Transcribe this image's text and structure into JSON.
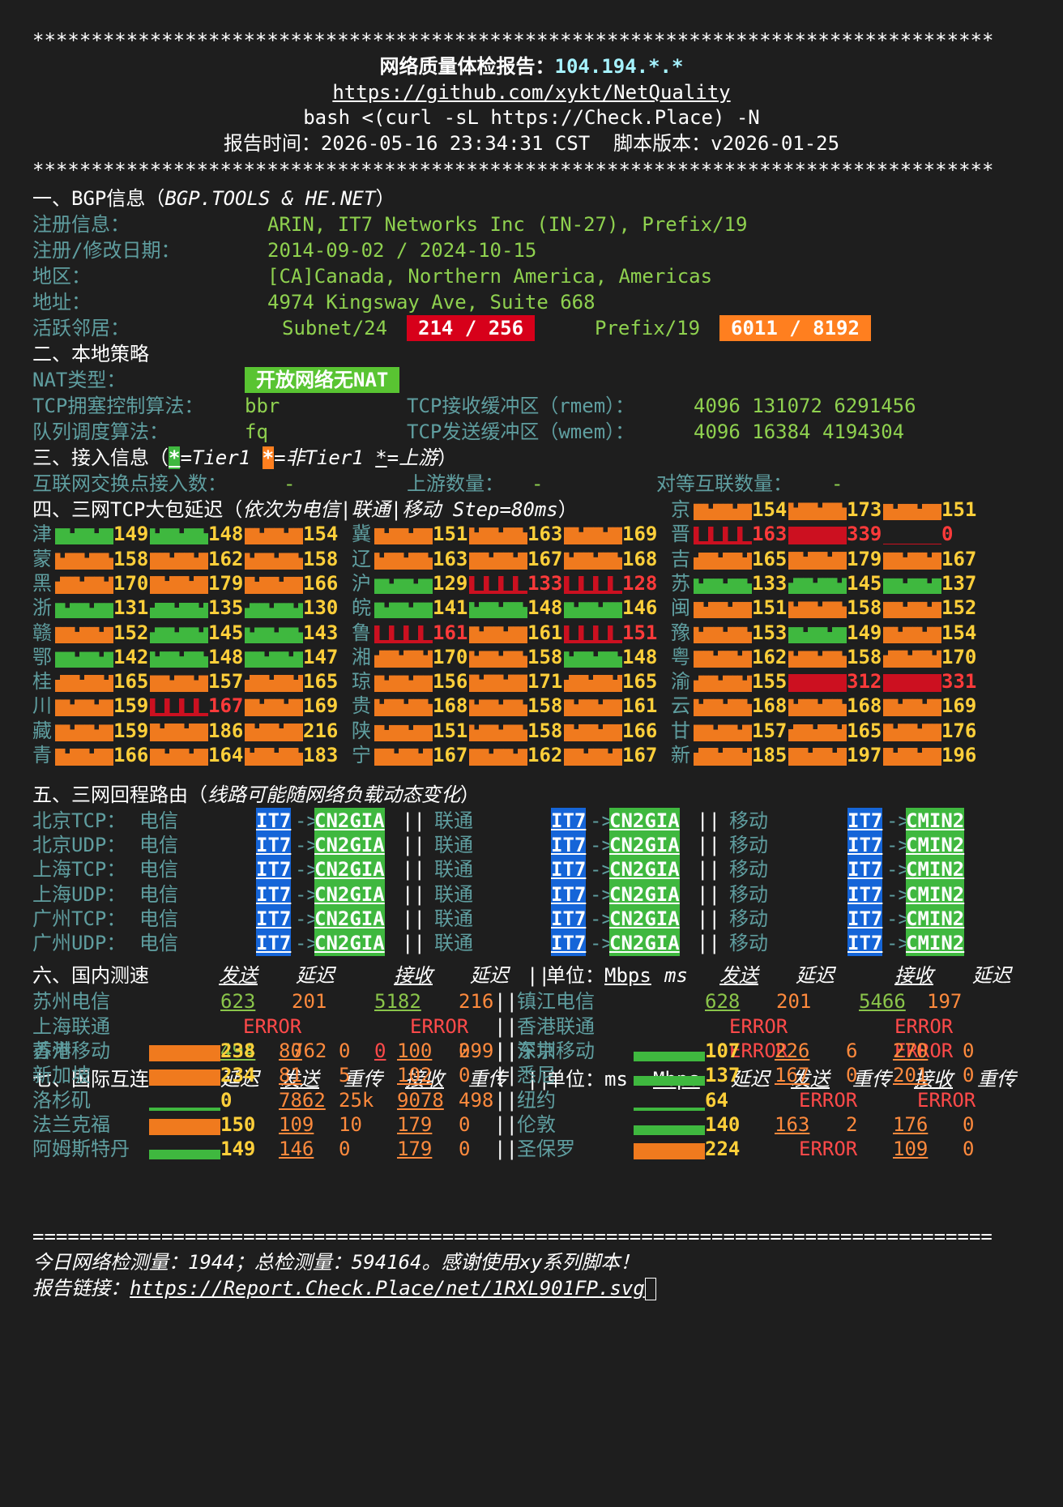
{
  "header": {
    "stars": "**********************************************************************************",
    "title": "网络质量体检报告：",
    "ip": "104.194.*.*",
    "repo": "https://github.com/xykt/NetQuality",
    "cmd": "bash <(curl -sL https://Check.Place) -N",
    "report_time": "报告时间：2026-05-16 23:34:31 CST  脚本版本：v2026-01-25"
  },
  "bgp": {
    "section": "一、BGP信息（",
    "section_src": "BGP.TOOLS & HE.NET",
    "section_end": "）",
    "rows": [
      {
        "label": "注册信息：",
        "value": "ARIN, IT7 Networks Inc (IN-27), Prefix/19"
      },
      {
        "label": "注册/修改日期：",
        "value": "2014-09-02 / 2024-10-15"
      },
      {
        "label": "地区：",
        "value": "[CA]Canada, Northern America, Americas"
      },
      {
        "label": "地址：",
        "value": "4974 Kingsway Ave, Suite 668"
      }
    ],
    "neighbor_label": "活跃邻居：",
    "subnet_label": "Subnet/24",
    "subnet_value": "214 / 256",
    "prefix_label": "Prefix/19",
    "prefix_value": "6011 / 8192"
  },
  "local": {
    "section": "二、本地策略",
    "nat_label": "NAT类型：",
    "nat_value": "开放网络无NAT",
    "tcp_cc_label": "TCP拥塞控制算法：",
    "tcp_cc": "bbr",
    "rmem_label": "TCP接收缓冲区（rmem）：",
    "rmem": "4096 131072 6291456",
    "qdisc_label": "队列调度算法：",
    "qdisc": "fq",
    "wmem_label": "TCP发送缓冲区（wmem）：",
    "wmem": "4096 16384 4194304"
  },
  "access": {
    "section": "三、接入信息（",
    "legend_star": "*",
    "tier1": "=Tier1 ",
    "nontier1": "=非Tier1 ",
    "upstream": "=上游",
    "section_end": "）",
    "ix_label": "互联网交换点接入数：",
    "ix_value": "-",
    "up_label": "上游数量：",
    "up_value": "-",
    "peer_label": "对等互联数量：",
    "peer_value": "-"
  },
  "latency": {
    "section": "四、三网TCP大包延迟（",
    "section_note": "依次为电信|联通|移动 Step=80ms",
    "section_end": "）",
    "colors": {
      "green": "#3fb83f",
      "orange": "#f07a1e",
      "red": "#cc1020"
    },
    "provinces": [
      {
        "n": "京",
        "v": [
          "154",
          "173",
          "151"
        ],
        "c": [
          "o",
          "o",
          "o"
        ]
      },
      {
        "n": "津",
        "v": [
          "149",
          "148",
          "154"
        ],
        "c": [
          "g",
          "g",
          "o"
        ]
      },
      {
        "n": "冀",
        "v": [
          "151",
          "163",
          "169"
        ],
        "c": [
          "o",
          "o",
          "o"
        ]
      },
      {
        "n": "晋",
        "v": [
          "163",
          "339",
          "0"
        ],
        "c": [
          "r",
          "r",
          "r"
        ]
      },
      {
        "n": "蒙",
        "v": [
          "158",
          "162",
          "158"
        ],
        "c": [
          "o",
          "o",
          "o"
        ]
      },
      {
        "n": "辽",
        "v": [
          "163",
          "167",
          "168"
        ],
        "c": [
          "o",
          "o",
          "o"
        ]
      },
      {
        "n": "吉",
        "v": [
          "165",
          "179",
          "167"
        ],
        "c": [
          "o",
          "o",
          "o"
        ]
      },
      {
        "n": "黑",
        "v": [
          "170",
          "179",
          "166"
        ],
        "c": [
          "o",
          "o",
          "o"
        ]
      },
      {
        "n": "沪",
        "v": [
          "129",
          "133",
          "128"
        ],
        "c": [
          "g",
          "r",
          "r"
        ]
      },
      {
        "n": "苏",
        "v": [
          "133",
          "145",
          "137"
        ],
        "c": [
          "g",
          "g",
          "g"
        ]
      },
      {
        "n": "浙",
        "v": [
          "131",
          "135",
          "130"
        ],
        "c": [
          "g",
          "g",
          "g"
        ]
      },
      {
        "n": "皖",
        "v": [
          "141",
          "148",
          "146"
        ],
        "c": [
          "g",
          "g",
          "g"
        ]
      },
      {
        "n": "闽",
        "v": [
          "151",
          "158",
          "152"
        ],
        "c": [
          "o",
          "o",
          "o"
        ]
      },
      {
        "n": "赣",
        "v": [
          "152",
          "145",
          "143"
        ],
        "c": [
          "o",
          "g",
          "g"
        ]
      },
      {
        "n": "鲁",
        "v": [
          "161",
          "161",
          "151"
        ],
        "c": [
          "r",
          "o",
          "r"
        ]
      },
      {
        "n": "豫",
        "v": [
          "153",
          "149",
          "154"
        ],
        "c": [
          "o",
          "g",
          "o"
        ]
      },
      {
        "n": "鄂",
        "v": [
          "142",
          "148",
          "147"
        ],
        "c": [
          "g",
          "g",
          "g"
        ]
      },
      {
        "n": "湘",
        "v": [
          "170",
          "158",
          "148"
        ],
        "c": [
          "o",
          "o",
          "g"
        ]
      },
      {
        "n": "粤",
        "v": [
          "162",
          "158",
          "170"
        ],
        "c": [
          "o",
          "o",
          "o"
        ]
      },
      {
        "n": "桂",
        "v": [
          "165",
          "157",
          "165"
        ],
        "c": [
          "o",
          "o",
          "o"
        ]
      },
      {
        "n": "琼",
        "v": [
          "156",
          "171",
          "165"
        ],
        "c": [
          "o",
          "o",
          "o"
        ]
      },
      {
        "n": "渝",
        "v": [
          "155",
          "312",
          "331"
        ],
        "c": [
          "o",
          "r",
          "r"
        ]
      },
      {
        "n": "川",
        "v": [
          "159",
          "167",
          "169"
        ],
        "c": [
          "o",
          "r",
          "o"
        ]
      },
      {
        "n": "贵",
        "v": [
          "168",
          "158",
          "161"
        ],
        "c": [
          "o",
          "o",
          "o"
        ]
      },
      {
        "n": "云",
        "v": [
          "168",
          "168",
          "169"
        ],
        "c": [
          "o",
          "o",
          "o"
        ]
      },
      {
        "n": "藏",
        "v": [
          "159",
          "186",
          "216"
        ],
        "c": [
          "o",
          "o",
          "o"
        ]
      },
      {
        "n": "陕",
        "v": [
          "151",
          "158",
          "166"
        ],
        "c": [
          "o",
          "o",
          "o"
        ]
      },
      {
        "n": "甘",
        "v": [
          "157",
          "165",
          "176"
        ],
        "c": [
          "o",
          "o",
          "o"
        ]
      },
      {
        "n": "青",
        "v": [
          "166",
          "164",
          "183"
        ],
        "c": [
          "o",
          "o",
          "o"
        ]
      },
      {
        "n": "宁",
        "v": [
          "167",
          "162",
          "167"
        ],
        "c": [
          "o",
          "o",
          "o"
        ]
      },
      {
        "n": "新",
        "v": [
          "185",
          "197",
          "196"
        ],
        "c": [
          "o",
          "o",
          "o"
        ]
      }
    ]
  },
  "route": {
    "section": "五、三网回程路由（",
    "section_note": "线路可能随网络负载动态变化",
    "section_end": "）",
    "rows": [
      {
        "label": "北京TCP："
      },
      {
        "label": "北京UDP："
      },
      {
        "label": "上海TCP："
      },
      {
        "label": "上海UDP："
      },
      {
        "label": "广州TCP："
      },
      {
        "label": "广州UDP："
      }
    ],
    "ct": "电信",
    "cu": "联通",
    "cm": "移动",
    "it7": "IT7",
    "arrow": "->",
    "cn2": "CN2GIA",
    "cmin2": "CMIN2",
    "sep": "||"
  },
  "speed": {
    "section": "六、国内测速",
    "send": "发送",
    "lat": "延迟",
    "recv": "接收",
    "sep": "||",
    "unit_label": "单位：",
    "unit_mbps": "Mbps",
    "unit_ms": "ms",
    "left": [
      {
        "name": "苏州电信",
        "send": "623",
        "lat1": "201",
        "recv": "5182",
        "lat2": "216"
      },
      {
        "name": "上海联通",
        "err1": "ERROR",
        "err2": "ERROR"
      },
      {
        "name": "苏州移动",
        "send": "494",
        "lat1": "762",
        "recv": "0",
        "lat2": "299"
      }
    ],
    "right": [
      {
        "name": "镇江电信",
        "send": "628",
        "lat1": "201",
        "recv": "5466",
        "lat2": "197"
      },
      {
        "name": "香港联通",
        "err1": "ERROR",
        "err2": "ERROR"
      },
      {
        "name": "深圳移动",
        "err1": "ERROR",
        "err2": "ERROR"
      }
    ]
  },
  "intl": {
    "section": "七、国际互连",
    "lat": "延迟",
    "send": "发送",
    "retx": "重传",
    "recv": "接收",
    "sep": "||",
    "unit_label": "单位：",
    "unit_ms": "ms",
    "unit_mbps": "Mbps",
    "left": [
      {
        "name": "香港",
        "lat": "238",
        "c": "o",
        "send": "80",
        "r1": "0",
        "recv": "100",
        "r2": "0"
      },
      {
        "name": "新加坡",
        "lat": "234",
        "c": "o",
        "send": "81",
        "r1": "5",
        "recv": "102",
        "r2": "0"
      },
      {
        "name": "洛杉矶",
        "lat": "0",
        "c": "g0",
        "send": "7862",
        "r1": "25k",
        "recv": "9078",
        "r2": "498"
      },
      {
        "name": "法兰克福",
        "lat": "150",
        "c": "o",
        "send": "109",
        "r1": "10",
        "recv": "179",
        "r2": "0"
      },
      {
        "name": "阿姆斯特丹",
        "lat": "149",
        "c": "g",
        "send": "146",
        "r1": "0",
        "recv": "179",
        "r2": "0"
      }
    ],
    "right": [
      {
        "name": "东京",
        "lat": "107",
        "c": "g",
        "send": "226",
        "r1": "6",
        "recv": "270",
        "r2": "0"
      },
      {
        "name": "悉尼",
        "lat": "137",
        "c": "g",
        "send": "167",
        "r1": "0",
        "recv": "201",
        "r2": "0"
      },
      {
        "name": "纽约",
        "lat": "64",
        "c": "g0",
        "err1": "ERROR",
        "err2": "ERROR"
      },
      {
        "name": "伦敦",
        "lat": "140",
        "c": "g",
        "send": "163",
        "r1": "2",
        "recv": "176",
        "r2": "0"
      },
      {
        "name": "圣保罗",
        "lat": "224",
        "c": "o",
        "err1": "ERROR",
        "recv": "109",
        "r2": "0"
      }
    ]
  },
  "footer": {
    "eq": "==================================================================================",
    "stats": "今日网络检测量：1944；总检测量：594164。感谢使用xy系列脚本！",
    "link_label": "报告链接：",
    "link": "https://Report.Check.Place/net/1RXL901FP.svg"
  }
}
